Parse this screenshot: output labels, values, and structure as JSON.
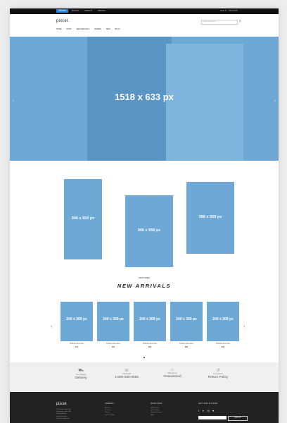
{
  "topbar": {
    "tabs": [
      "DEMO01",
      "DEMO02",
      "DEMO03",
      "DEMO04"
    ],
    "right_text": "SIGN IN · REGISTER"
  },
  "header": {
    "logo": "pixcel.",
    "search_placeholder": "Search products",
    "nav": [
      "HOME",
      "SHOP",
      "NEW ARRIVALS",
      "WOMEN",
      "MEN",
      "BLOG"
    ]
  },
  "hero": {
    "label": "1518 x 633 px"
  },
  "categories": [
    {
      "label": "366 x 550 px"
    },
    {
      "label": "366 x 550 px"
    },
    {
      "label": "366 x 550 px"
    }
  ],
  "section": {
    "eyebrow": "FEATURED",
    "title": "NEW ARRIVALS"
  },
  "products": [
    {
      "image_label": "240 x 300 px",
      "name": "Product name here",
      "price": "$79"
    },
    {
      "image_label": "240 x 300 px",
      "name": "Product name here",
      "price": "$49"
    },
    {
      "image_label": "240 x 300 px",
      "name": "Product name here",
      "price": "$89"
    },
    {
      "image_label": "240 x 300 px",
      "name": "Product name here",
      "price": "$99"
    },
    {
      "image_label": "240 x 300 px",
      "name": "Product name here",
      "price": "$59"
    }
  ],
  "features": [
    {
      "small": "Free Shipping",
      "main": "Delivery"
    },
    {
      "small": "Call Support",
      "main": "1-800-000-0000"
    },
    {
      "small": "100% Secure",
      "main": "Guaranteed"
    },
    {
      "small": "Free Returns",
      "main": "Return Policy"
    }
  ],
  "footer": {
    "logo": "pixcel.",
    "address": [
      "123 Street, Suite 100",
      "City Name, State 000",
      "Country Name",
      "(000) 000-0000",
      "info@example.com"
    ],
    "company_title": "COMPANY",
    "company_links": [
      "About Us",
      "Contact",
      "Careers",
      "Privacy Policy"
    ],
    "quick_title": "QUICK LINKS",
    "quick_links": [
      "My Account",
      "Order Status",
      "Shipping Returns",
      "FAQ"
    ],
    "newsletter_title": "LET'S STAY IN TOUCH",
    "signup_label": "SIGN UP"
  }
}
